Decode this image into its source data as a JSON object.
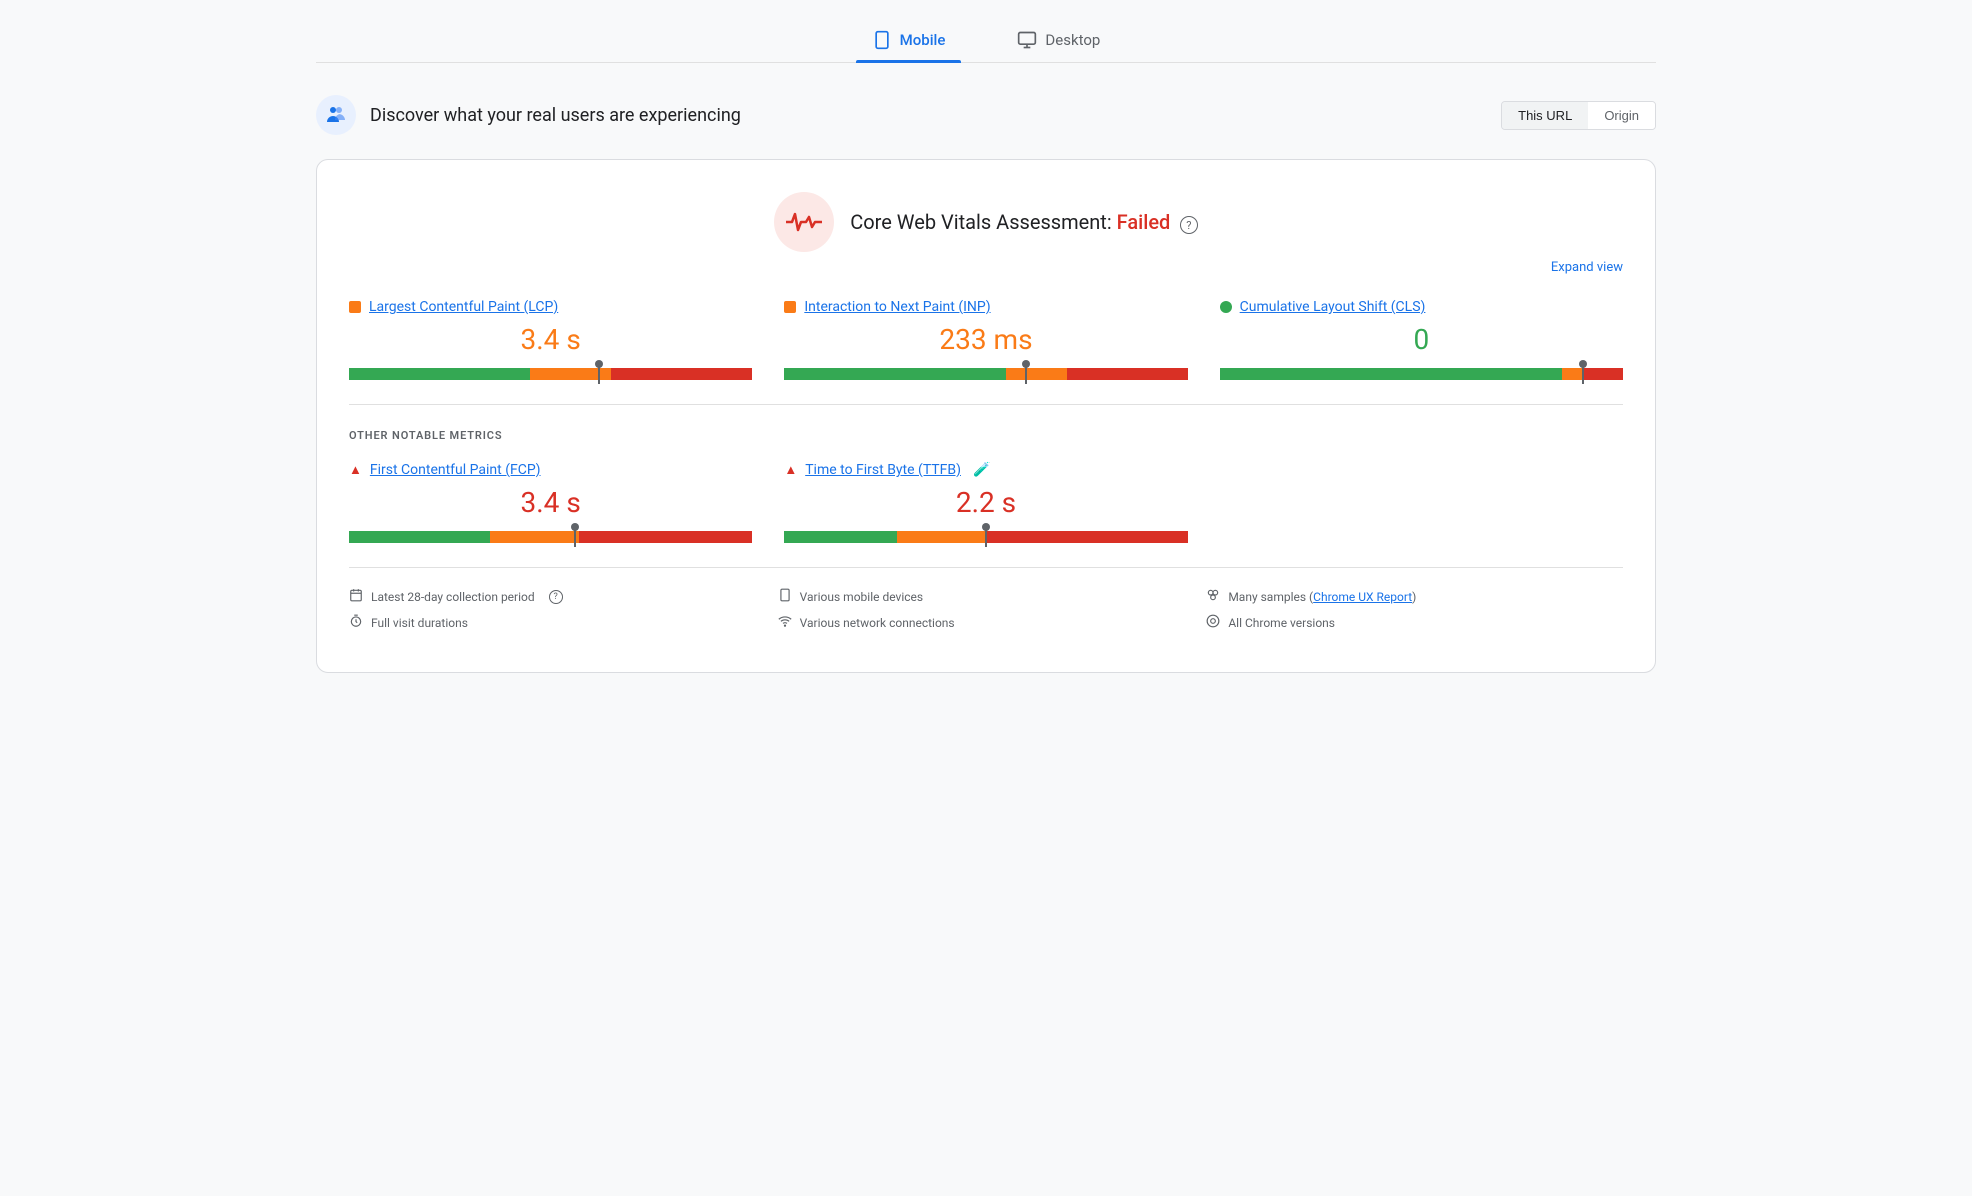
{
  "tabs": [
    {
      "id": "mobile",
      "label": "Mobile",
      "active": true
    },
    {
      "id": "desktop",
      "label": "Desktop",
      "active": false
    }
  ],
  "header": {
    "title": "Discover what your real users are experiencing",
    "url_toggle": {
      "this_url": "This URL",
      "origin": "Origin",
      "active": "this_url"
    }
  },
  "assessment": {
    "title_prefix": "Core Web Vitals Assessment: ",
    "status": "Failed",
    "expand_label": "Expand view"
  },
  "core_metrics": [
    {
      "id": "lcp",
      "label": "Largest Contentful Paint (LCP)",
      "dot_color": "orange",
      "value": "3.4 s",
      "value_color": "orange",
      "bar": {
        "green_pct": 45,
        "orange_pct": 20,
        "red_pct": 35,
        "marker_pct": 62
      }
    },
    {
      "id": "inp",
      "label": "Interaction to Next Paint (INP)",
      "dot_color": "orange",
      "value": "233 ms",
      "value_color": "orange",
      "bar": {
        "green_pct": 55,
        "orange_pct": 15,
        "red_pct": 30,
        "marker_pct": 60
      }
    },
    {
      "id": "cls",
      "label": "Cumulative Layout Shift (CLS)",
      "dot_color": "green",
      "dot_shape": "circle",
      "value": "0",
      "value_color": "green",
      "bar": {
        "green_pct": 85,
        "orange_pct": 5,
        "red_pct": 10,
        "marker_pct": 90
      }
    }
  ],
  "other_metrics_label": "OTHER NOTABLE METRICS",
  "other_metrics": [
    {
      "id": "fcp",
      "label": "First Contentful Paint (FCP)",
      "icon": "triangle",
      "value": "3.4 s",
      "value_color": "red",
      "bar": {
        "green_pct": 35,
        "orange_pct": 22,
        "red_pct": 43,
        "marker_pct": 56
      }
    },
    {
      "id": "ttfb",
      "label": "Time to First Byte (TTFB)",
      "icon": "triangle",
      "has_flask": true,
      "value": "2.2 s",
      "value_color": "red",
      "bar": {
        "green_pct": 28,
        "orange_pct": 22,
        "red_pct": 50,
        "marker_pct": 50
      }
    },
    {
      "id": "empty",
      "label": "",
      "value": ""
    }
  ],
  "footer": {
    "col1": [
      {
        "icon": "📅",
        "text": "Latest 28-day collection period",
        "has_help": true
      },
      {
        "icon": "⏱",
        "text": "Full visit durations"
      }
    ],
    "col2": [
      {
        "icon": "📱",
        "text": "Various mobile devices"
      },
      {
        "icon": "📶",
        "text": "Various network connections"
      }
    ],
    "col3": [
      {
        "icon": "⚬",
        "text_prefix": "Many samples ",
        "link_text": "Chrome UX Report",
        "text_suffix": ""
      },
      {
        "icon": "⊙",
        "text": "All Chrome versions"
      }
    ]
  }
}
